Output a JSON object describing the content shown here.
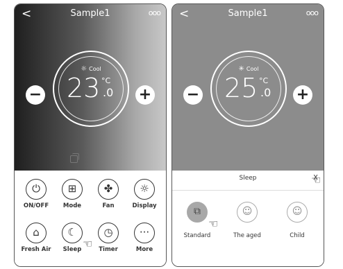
{
  "left_screen": {
    "back_icon": "chevron-left-icon",
    "title": "Sample1",
    "more_icon": "more-dots-icon",
    "mode": "Cool",
    "mode_icon": "sun-icon",
    "temp_int": "23",
    "unit": "°C",
    "temp_dec": ".0",
    "minus": "−",
    "plus": "+",
    "buttons": [
      {
        "label": "ON/OFF",
        "icon": "power-icon",
        "glyph": "⏻"
      },
      {
        "label": "Mode",
        "icon": "mode-icon",
        "glyph": "⊞"
      },
      {
        "label": "Fan",
        "icon": "fan-icon",
        "glyph": "✤"
      },
      {
        "label": "Display",
        "icon": "display-icon",
        "glyph": "☼"
      },
      {
        "label": "Fresh Air",
        "icon": "home-icon",
        "glyph": "⌂"
      },
      {
        "label": "Sleep",
        "icon": "sleep-icon",
        "glyph": "☾"
      },
      {
        "label": "Timer",
        "icon": "timer-icon",
        "glyph": "◷"
      },
      {
        "label": "More",
        "icon": "more-icon",
        "glyph": "···"
      }
    ]
  },
  "right_screen": {
    "back_icon": "chevron-left-icon",
    "title": "Sample1",
    "more_icon": "more-dots-icon",
    "mode": "Cool",
    "mode_icon": "snowflake-icon",
    "temp_int": "25",
    "unit": "°C",
    "temp_dec": ".0",
    "minus": "−",
    "plus": "+",
    "sheet_title": "Sleep",
    "close_label": "X",
    "options": [
      {
        "label": "Standard",
        "icon": "standard-sleep-icon",
        "glyph": "⧉",
        "selected": true
      },
      {
        "label": "The aged",
        "icon": "aged-face-icon",
        "glyph": "☺",
        "selected": false
      },
      {
        "label": "Child",
        "icon": "child-face-icon",
        "glyph": "☺",
        "selected": false
      }
    ]
  },
  "colors": {
    "accent": "#ffffff",
    "dark_bg": "#1f1f1f",
    "grey_bg": "#8c8c8c"
  }
}
